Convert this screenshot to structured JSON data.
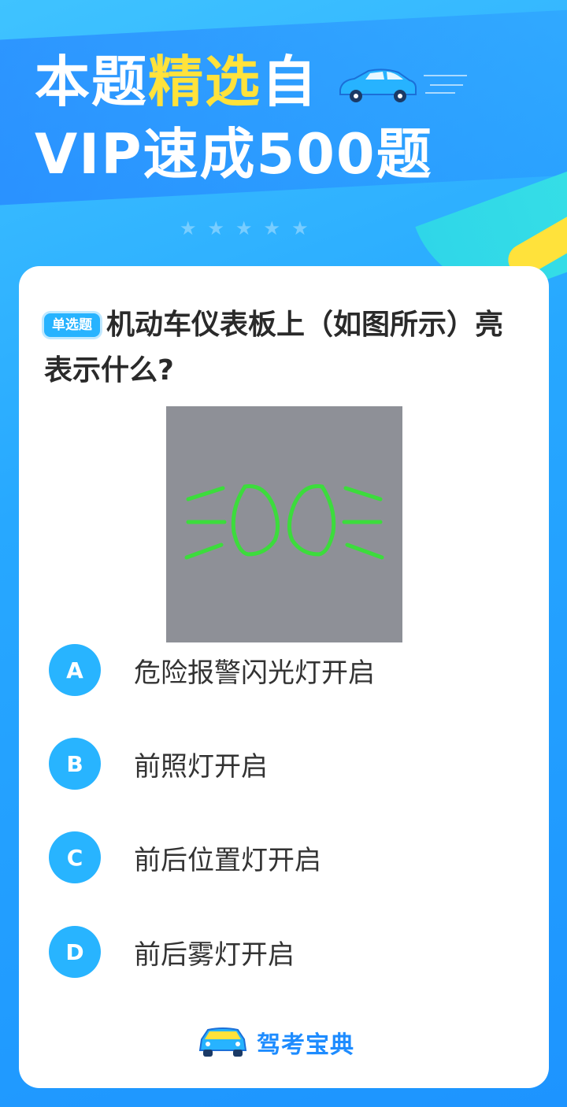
{
  "header": {
    "line1_part1": "本题",
    "line1_highlight": "精选",
    "line1_part2": "自",
    "line2": "VIP速成500题"
  },
  "question": {
    "tag": "单选题",
    "text": "机动车仪表板上（如图所示）亮表示什么?"
  },
  "image": {
    "icon": "headlight-indicator-icon",
    "watermark": "驾考宝典"
  },
  "options": [
    {
      "letter": "A",
      "text": "危险报警闪光灯开启"
    },
    {
      "letter": "B",
      "text": "前照灯开启"
    },
    {
      "letter": "C",
      "text": "前后位置灯开启"
    },
    {
      "letter": "D",
      "text": "前后雾灯开启"
    }
  ],
  "brand": {
    "name": "驾考宝典",
    "icon": "car-logo-icon"
  },
  "colors": {
    "accent": "#28b4ff",
    "highlight": "#ffe23b",
    "icon_green": "#3cdc3c"
  }
}
